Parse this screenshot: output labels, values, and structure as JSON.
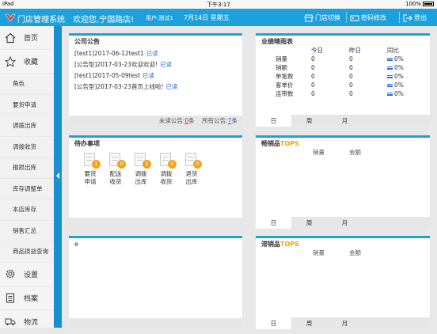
{
  "status_bar": {
    "device": "iPad",
    "time": "下午3:17",
    "battery": "100%"
  },
  "header": {
    "app_title": "门店管理系统",
    "welcome": "欢迎您,宁国路店!",
    "user": "用户:测试1",
    "date": "7月14日 星期五",
    "switch_store": "门店切换",
    "change_password": "密码修改",
    "logout": "登出"
  },
  "sidebar": {
    "top_items": [
      {
        "label": "首页",
        "icon": "home-icon"
      },
      {
        "label": "收藏",
        "icon": "star-icon"
      }
    ],
    "sub_items": [
      "角色",
      "要货申请",
      "调拨出库",
      "调拨收货",
      "报损出库",
      "库存调整单",
      "本店库存",
      "销售汇总",
      "商品损益查询"
    ],
    "bottom_items": [
      {
        "label": "设置",
        "icon": "gear-icon"
      },
      {
        "label": "档案",
        "icon": "clipboard-icon"
      },
      {
        "label": "物流",
        "icon": "truck-icon"
      }
    ]
  },
  "announcements": {
    "title": "公司公告",
    "items": [
      {
        "text": "[test1]2017-06-12test1",
        "status": "已读"
      },
      {
        "text": "[公告型]2017-03-23欢迎欢迎!",
        "status": "已读"
      },
      {
        "text": "[test1]2017-05-09test",
        "status": "已读"
      },
      {
        "text": "[公告型]2017-03-23首页上线啦!",
        "status": "已读"
      }
    ],
    "unread_label": "未读公告:",
    "unread_count": "0",
    "unread_unit": "条",
    "all_label": "所有公告:",
    "all_count": "7",
    "all_unit": "条"
  },
  "performance": {
    "title": "业绩晴雨表",
    "columns": [
      "今日",
      "昨日",
      "同比"
    ],
    "rows": [
      {
        "label": "销量",
        "today": "0",
        "yesterday": "0",
        "yoy": "0%"
      },
      {
        "label": "销额",
        "today": "0",
        "yesterday": "0",
        "yoy": "0%"
      },
      {
        "label": "单笔数",
        "today": "0",
        "yesterday": "0",
        "yoy": "0%"
      },
      {
        "label": "客单价",
        "today": "0",
        "yesterday": "0",
        "yoy": "0%"
      },
      {
        "label": "连带数",
        "today": "0",
        "yesterday": "0",
        "yoy": "0%"
      }
    ],
    "tabs": [
      "日",
      "周",
      "月"
    ]
  },
  "todo": {
    "title": "待办事项",
    "items": [
      {
        "line1": "要货",
        "line2": "申请",
        "count": "1"
      },
      {
        "line1": "配送",
        "line2": "收货",
        "count": "0"
      },
      {
        "line1": "调拨",
        "line2": "出库",
        "count": "1"
      },
      {
        "line1": "调拨",
        "line2": "收货",
        "count": "0"
      },
      {
        "line1": "退货",
        "line2": "出库",
        "count": "0"
      }
    ]
  },
  "bestsellers": {
    "title": "畅销品",
    "tops": "TOPS",
    "columns": [
      "销量",
      "金额"
    ],
    "tabs": [
      "日",
      "周",
      "月"
    ]
  },
  "slowsellers": {
    "title": "滞销品",
    "tops": "TOPS",
    "columns": [
      "销量",
      "金额"
    ],
    "tabs": [
      "日",
      "周",
      "月"
    ]
  },
  "misc_panel": {
    "text": "e"
  },
  "colors": {
    "accent": "#1ea0dd",
    "tops": "#f0a400",
    "badge": "#f4a21b",
    "link": "#2b6de0",
    "unread": "#e03030"
  }
}
